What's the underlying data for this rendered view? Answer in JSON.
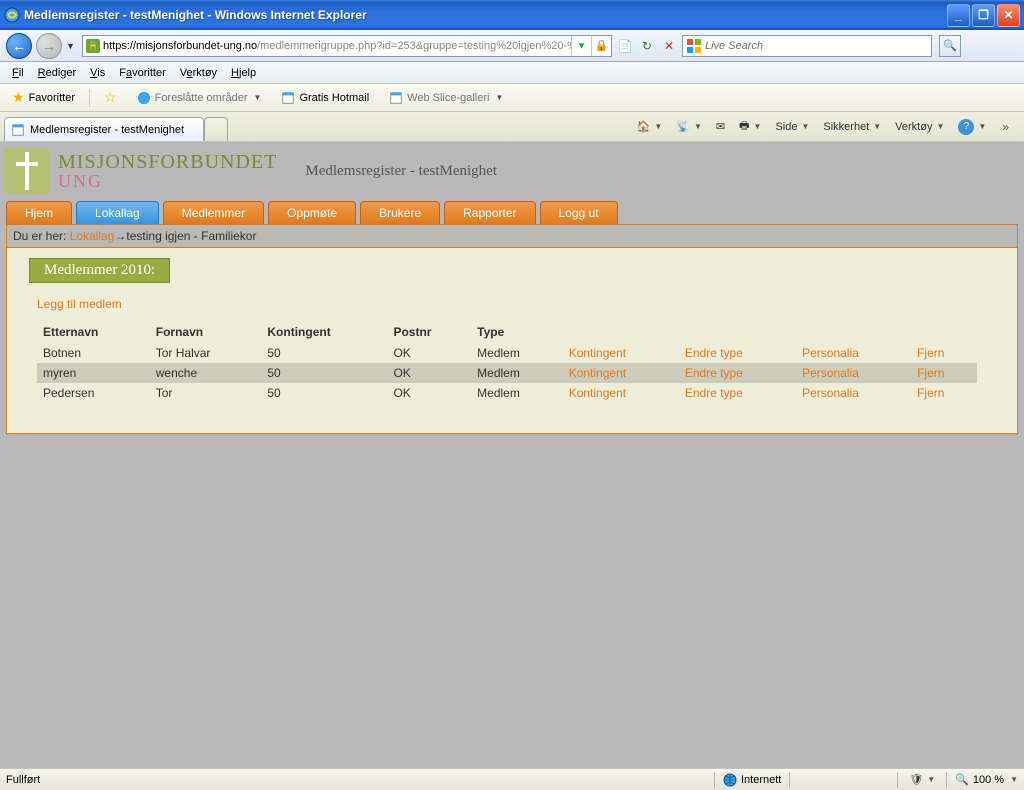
{
  "window": {
    "title": "Medlemsregister - testMenighet - Windows Internet Explorer"
  },
  "address": {
    "scheme": "https://",
    "host": "misjonsforbundet-ung.no",
    "path": "/medlemmerigruppe.php?id=253&gruppe=testing%20igjen%20-%"
  },
  "search": {
    "placeholder": "Live Search"
  },
  "menu": {
    "file": "Fil",
    "edit": "Rediger",
    "view": "Vis",
    "favorites": "Favoritter",
    "tools": "Verktøy",
    "help": "Hjelp"
  },
  "favbar": {
    "favorites": "Favoritter",
    "suggested": "Foreslåtte områder",
    "hotmail": "Gratis Hotmail",
    "webslice": "Web Slice-galleri"
  },
  "tab": {
    "title": "Medlemsregister - testMenighet"
  },
  "cmd": {
    "side": "Side",
    "sikkerhet": "Sikkerhet",
    "verktoy": "Verktøy"
  },
  "logo": {
    "line1": "MISJONSFORBUNDET",
    "line2": "UNG"
  },
  "pageTitle": "Medlemsregister - testMenighet",
  "navtabs": [
    "Hjem",
    "Lokallag",
    "Medlemmer",
    "Oppmøte",
    "Brukere",
    "Rapporter",
    "Logg ut"
  ],
  "breadcrumb": {
    "prefix": "Du er her: ",
    "link": "Lokallag",
    "tail": "→testing igjen - Familiekor"
  },
  "sectionHead": "Medlemmer 2010:",
  "addLink": "Legg til medlem",
  "table": {
    "headers": [
      "Etternavn",
      "Fornavn",
      "Kontingent",
      "Postnr",
      "Type",
      "",
      "",
      "",
      ""
    ],
    "rows": [
      {
        "etternavn": "Botnen",
        "fornavn": "Tor Halvar",
        "kont": "50",
        "post": "OK",
        "type": "Medlem",
        "a1": "Kontingent",
        "a2": "Endre type",
        "a3": "Personalia",
        "a4": "Fjern"
      },
      {
        "etternavn": "myren",
        "fornavn": "wenche",
        "kont": "50",
        "post": "OK",
        "type": "Medlem",
        "a1": "Kontingent",
        "a2": "Endre type",
        "a3": "Personalia",
        "a4": "Fjern"
      },
      {
        "etternavn": "Pedersen",
        "fornavn": "Tor",
        "kont": "50",
        "post": "OK",
        "type": "Medlem",
        "a1": "Kontingent",
        "a2": "Endre type",
        "a3": "Personalia",
        "a4": "Fjern"
      }
    ]
  },
  "status": {
    "done": "Fullført",
    "zone": "Internett",
    "zoom": "100 %"
  }
}
